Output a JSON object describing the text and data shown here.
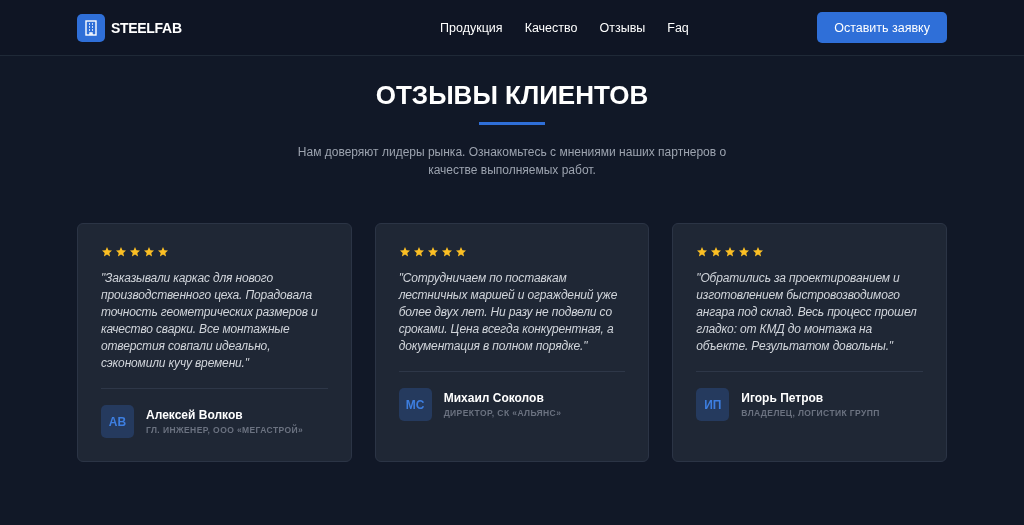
{
  "header": {
    "logo": "STEELFAB",
    "nav": [
      "Продукция",
      "Качество",
      "Отзывы",
      "Faq"
    ],
    "cta": "Оставить заявку"
  },
  "section": {
    "title": "ОТЗЫВЫ КЛИЕНТОВ",
    "subtitle": "Нам доверяют лидеры рынка. Ознакомьтесь с мнениями наших партнеров о качестве выполняемых работ."
  },
  "reviews": [
    {
      "stars": 5,
      "quote": "\"Заказывали каркас для нового производственного цеха. Порадовала точность геометрических размеров и качество сварки. Все монтажные отверстия совпали идеально, сэкономили кучу времени.\"",
      "initials": "АВ",
      "name": "Алексей Волков",
      "role": "ГЛ. ИНЖЕНЕР, ООО «МЕГАСТРОЙ»"
    },
    {
      "stars": 5,
      "quote": "\"Сотрудничаем по поставкам лестничных маршей и ограждений уже более двух лет. Ни разу не подвели со сроками. Цена всегда конкурентная, а документация в полном порядке.\"",
      "initials": "МС",
      "name": "Михаил Соколов",
      "role": "ДИРЕКТОР, СК «АЛЬЯНС»"
    },
    {
      "stars": 5,
      "quote": "\"Обратились за проектированием и изготовлением быстровозводимого ангара под склад. Весь процесс прошел гладко: от КМД до монтажа на объекте. Результатом довольны.\"",
      "initials": "ИП",
      "name": "Игорь Петров",
      "role": "ВЛАДЕЛЕЦ, ЛОГИСТИК ГРУПП"
    }
  ]
}
